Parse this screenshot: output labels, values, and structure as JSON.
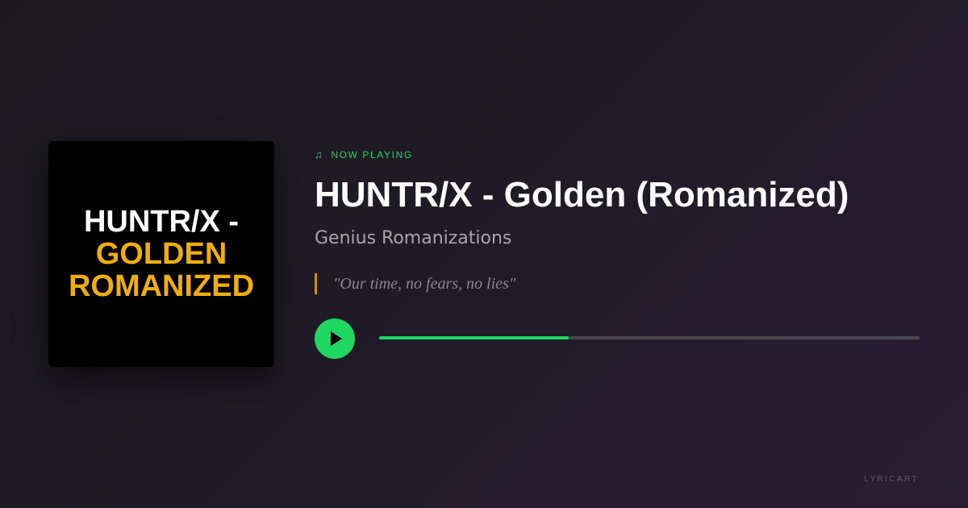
{
  "album_art": {
    "line1": "HUNTR/X -",
    "line2": "GOLDEN",
    "line3": "ROMANIZED"
  },
  "player": {
    "status_label": "NOW PLAYING",
    "status_icon": "music-note-icon",
    "title": "HUNTR/X - Golden (Romanized)",
    "artist": "Genius Romanizations",
    "quote": "\"Our time, no fears, no lies\"",
    "play_icon": "play-icon",
    "progress_fraction": 0.35
  },
  "brand": {
    "label": "LYRICART"
  },
  "colors": {
    "accent": "#1ed760",
    "art_highlight": "#f0ae0c",
    "quote_bar": "#c8930f"
  }
}
